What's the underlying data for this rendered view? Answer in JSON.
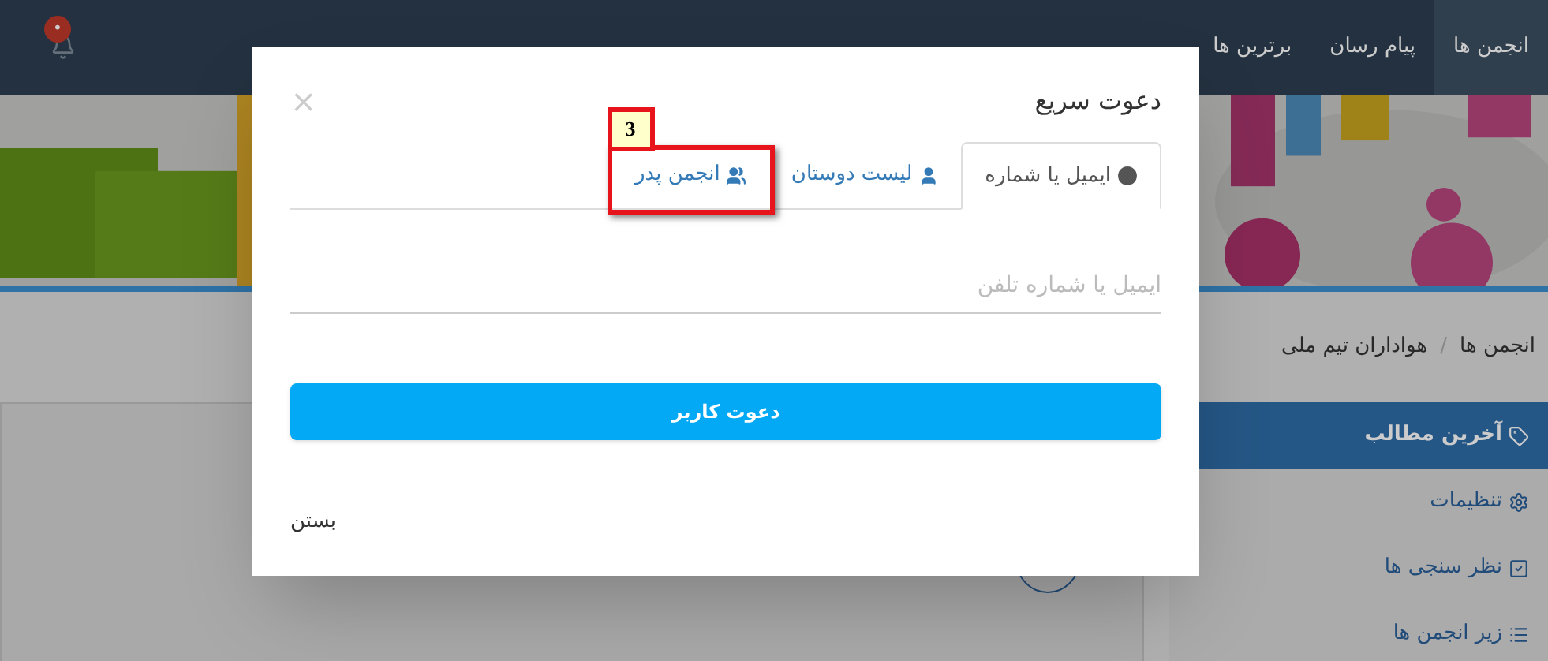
{
  "navbar": {
    "items": [
      {
        "label": "انجمن ها",
        "selected": true
      },
      {
        "label": "پیام رسان",
        "selected": false
      },
      {
        "label": "برترین ها",
        "selected": false
      }
    ],
    "notification_badge": "•"
  },
  "breadcrumb": {
    "items": [
      "انجمن ها",
      "هواداران تیم ملی"
    ],
    "separator": "/"
  },
  "sidebar": {
    "items": [
      {
        "label": "آخرین مطالب",
        "selected": true
      },
      {
        "label": "تنظیمات",
        "selected": false
      },
      {
        "label": "نظر سنجی ها",
        "selected": false
      },
      {
        "label": "زیر انجمن ها",
        "selected": false
      }
    ]
  },
  "dialog": {
    "title": "دعوت سریع",
    "close": "×",
    "tabs": [
      {
        "label": "ایمیل یا شماره",
        "selected": true
      },
      {
        "label": "لیست دوستان",
        "selected": false
      },
      {
        "label": "انجمن پدر",
        "selected": false,
        "annotation": "3"
      }
    ],
    "field": {
      "placeholder": "ایمیل یا شماره تلفن"
    },
    "submit": "دعوت کاربر",
    "dismiss": "بستن"
  }
}
